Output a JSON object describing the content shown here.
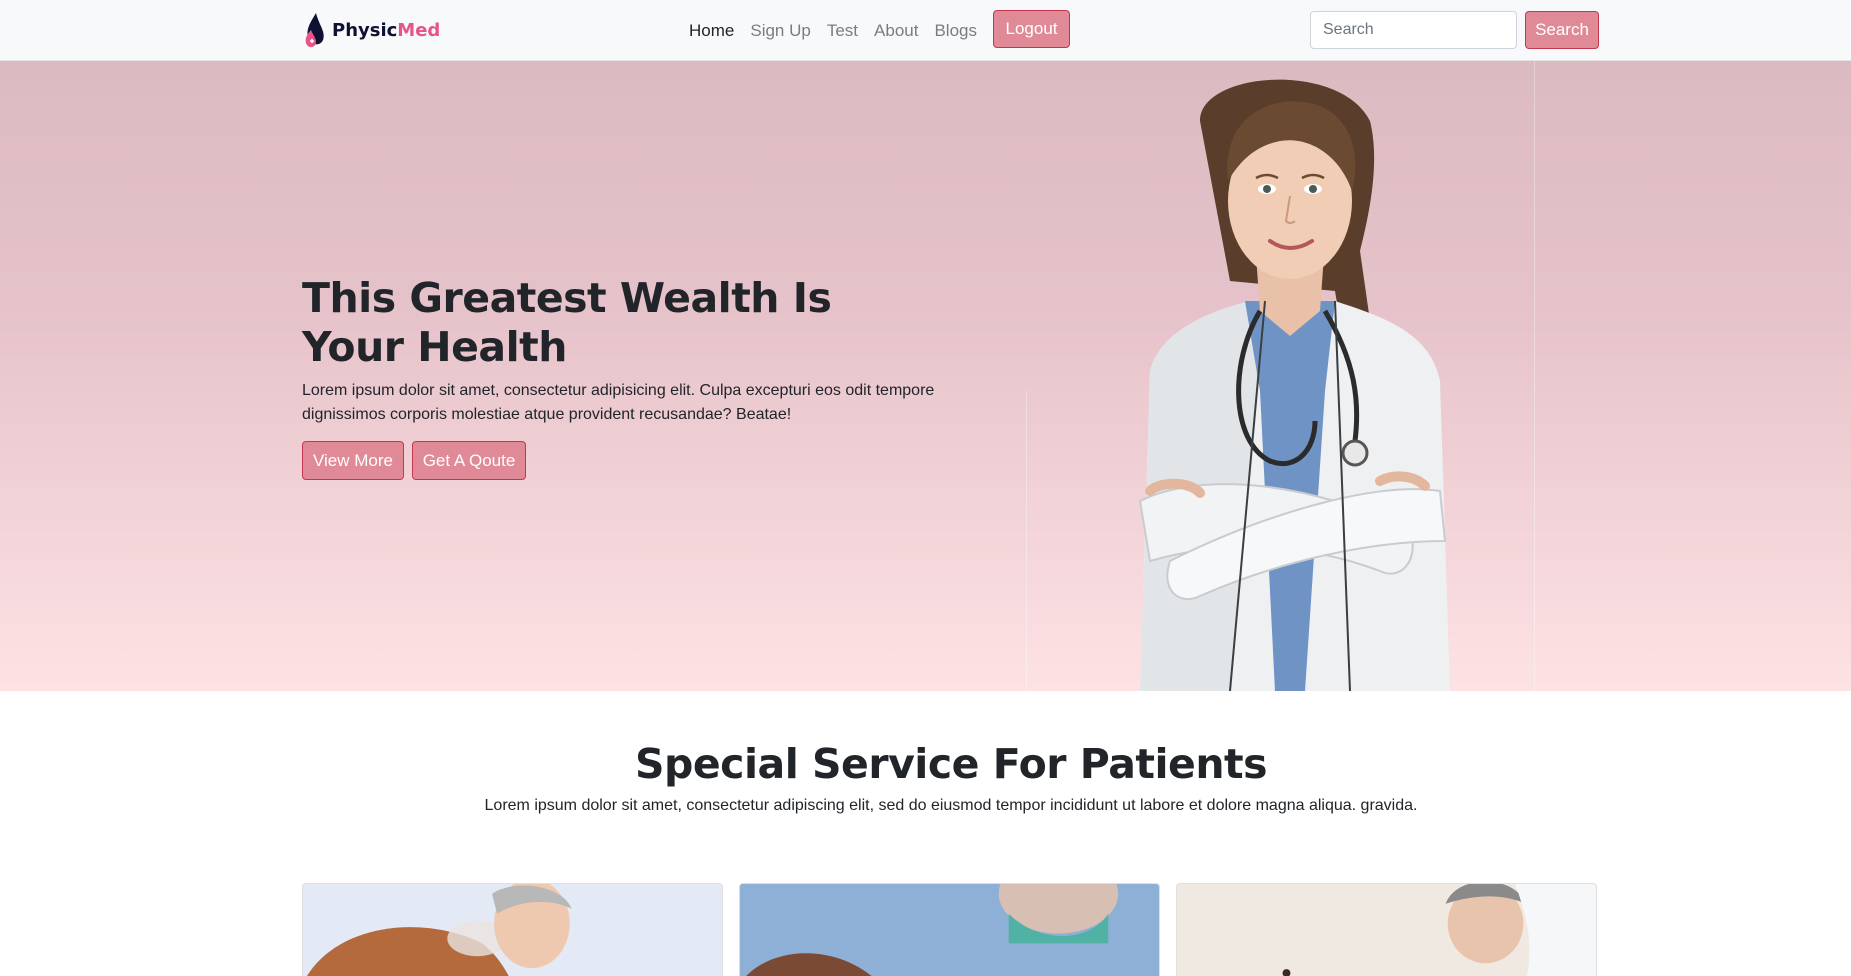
{
  "brand": {
    "name_part1": "Physic",
    "name_part2": "Med"
  },
  "nav": {
    "items": [
      {
        "label": "Home",
        "active": true
      },
      {
        "label": "Sign Up",
        "active": false
      },
      {
        "label": "Test",
        "active": false
      },
      {
        "label": "About",
        "active": false
      },
      {
        "label": "Blogs",
        "active": false
      }
    ],
    "logout_label": "Logout",
    "search_placeholder": "Search",
    "search_button": "Search"
  },
  "hero": {
    "title": "This Greatest Wealth Is Your Health",
    "text": "Lorem ipsum dolor sit amet, consectetur adipisicing elit. Culpa excepturi eos odit tempore dignissimos corporis molestiae atque provident recusandae? Beatae!",
    "btn_view_more": "View More",
    "btn_quote": "Get A Qoute"
  },
  "services": {
    "title": "Special Service For Patients",
    "subtitle": "Lorem ipsum dolor sit amet, consectetur adipiscing elit, sed do eiusmod tempor incididunt ut labore et dolore magna aliqua. gravida."
  },
  "colors": {
    "accent": "#e08a98",
    "accent_border": "#c5374f",
    "brand_dark": "#0f1133",
    "brand_pink": "#e8538a",
    "hero_top": "#dcbac1",
    "hero_bottom": "#fde2e4"
  }
}
